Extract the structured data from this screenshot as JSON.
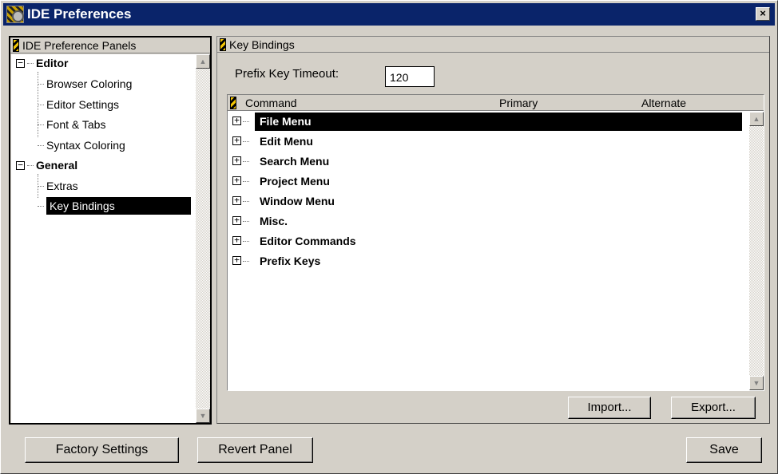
{
  "window": {
    "title": "IDE Preferences",
    "close_label": "×"
  },
  "left_panel": {
    "header": "IDE Preference Panels",
    "groups": [
      {
        "label": "Editor",
        "expander": "−",
        "items": [
          "Browser Coloring",
          "Editor Settings",
          "Font & Tabs",
          "Syntax Coloring"
        ]
      },
      {
        "label": "General",
        "expander": "−",
        "items": [
          "Extras",
          "Key Bindings"
        ]
      }
    ],
    "selected": "Key Bindings"
  },
  "right_panel": {
    "header": "Key Bindings",
    "timeout_label": "Prefix Key Timeout:",
    "timeout_value": "120",
    "columns": {
      "command": "Command",
      "primary": "Primary",
      "alternate": "Alternate"
    },
    "rows": [
      {
        "label": "File Menu",
        "expander": "+"
      },
      {
        "label": "Edit Menu",
        "expander": "+"
      },
      {
        "label": "Search Menu",
        "expander": "+"
      },
      {
        "label": "Project Menu",
        "expander": "+"
      },
      {
        "label": "Window Menu",
        "expander": "+"
      },
      {
        "label": "Misc.",
        "expander": "+"
      },
      {
        "label": "Editor Commands",
        "expander": "+"
      },
      {
        "label": "Prefix Keys",
        "expander": "+"
      }
    ],
    "selected_row": "File Menu",
    "import_label": "Import...",
    "export_label": "Export..."
  },
  "footer": {
    "factory_label": "Factory Settings",
    "revert_label": "Revert Panel",
    "save_label": "Save"
  },
  "icons": {
    "app": "gear-icon",
    "grip": "grip-icon",
    "scroll_up": "arrow-up-icon",
    "scroll_down": "arrow-down-icon"
  },
  "colors": {
    "titlebar": "#0a246a",
    "face": "#d4d0c8",
    "selection": "#000000"
  }
}
